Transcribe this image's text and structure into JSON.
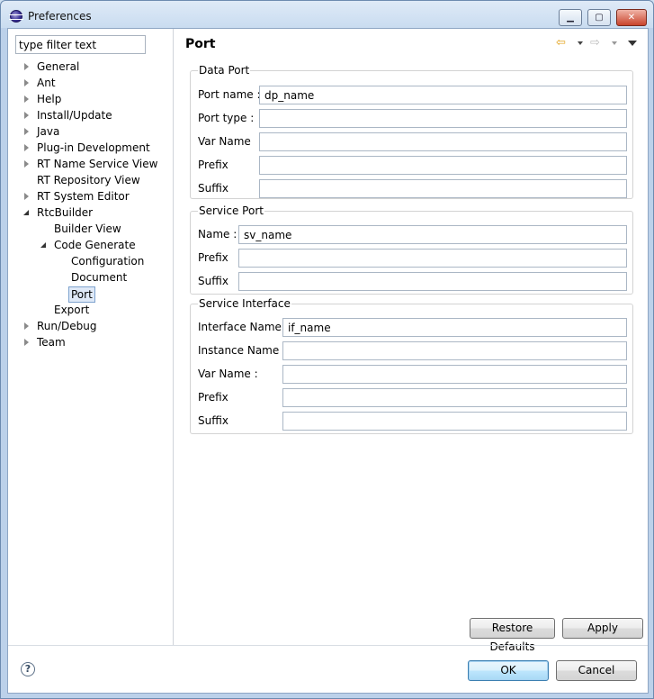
{
  "window": {
    "title": "Preferences"
  },
  "titlebar_buttons": {
    "minimize": "▁",
    "maximize": "▢",
    "close": "✕"
  },
  "sidebar": {
    "filter_value": "type filter text",
    "items": [
      {
        "label": "General",
        "state": "collapsed"
      },
      {
        "label": "Ant",
        "state": "collapsed"
      },
      {
        "label": "Help",
        "state": "collapsed"
      },
      {
        "label": "Install/Update",
        "state": "collapsed"
      },
      {
        "label": "Java",
        "state": "collapsed"
      },
      {
        "label": "Plug-in Development",
        "state": "collapsed"
      },
      {
        "label": "RT Name Service View",
        "state": "collapsed"
      },
      {
        "label": "RT Repository View",
        "state": "leaf"
      },
      {
        "label": "RT System Editor",
        "state": "collapsed"
      },
      {
        "label": "RtcBuilder",
        "state": "expanded"
      },
      {
        "label": "Builder View",
        "state": "leaf"
      },
      {
        "label": "Code Generate",
        "state": "expanded"
      },
      {
        "label": "Configuration",
        "state": "leaf"
      },
      {
        "label": "Document",
        "state": "leaf"
      },
      {
        "label": "Port",
        "state": "selected"
      },
      {
        "label": "Export",
        "state": "leaf"
      },
      {
        "label": "Run/Debug",
        "state": "collapsed"
      },
      {
        "label": "Team",
        "state": "collapsed"
      }
    ]
  },
  "main": {
    "page_title": "Port",
    "nav": {
      "back_icon": "⇦",
      "forward_icon": "⇨"
    },
    "data_port": {
      "title": "Data Port",
      "fields": [
        {
          "label": "Port name :",
          "value": "dp_name"
        },
        {
          "label": "Port type :",
          "value": ""
        },
        {
          "label": "Var Name",
          "value": ""
        },
        {
          "label": "Prefix",
          "value": ""
        },
        {
          "label": "Suffix",
          "value": ""
        }
      ]
    },
    "service_port": {
      "title": "Service Port",
      "fields": [
        {
          "label": "Name :",
          "value": "sv_name"
        },
        {
          "label": "Prefix",
          "value": ""
        },
        {
          "label": "Suffix",
          "value": ""
        }
      ]
    },
    "service_interface": {
      "title": "Service Interface",
      "fields": [
        {
          "label": "Interface Name :",
          "value": "if_name"
        },
        {
          "label": "Instance Name :",
          "value": ""
        },
        {
          "label": "Var Name :",
          "value": ""
        },
        {
          "label": "Prefix",
          "value": ""
        },
        {
          "label": "Suffix",
          "value": ""
        }
      ]
    },
    "restore_defaults_label": "Restore Defaults",
    "apply_label": "Apply"
  },
  "footer": {
    "help_icon": "?",
    "ok_label": "OK",
    "cancel_label": "Cancel"
  }
}
